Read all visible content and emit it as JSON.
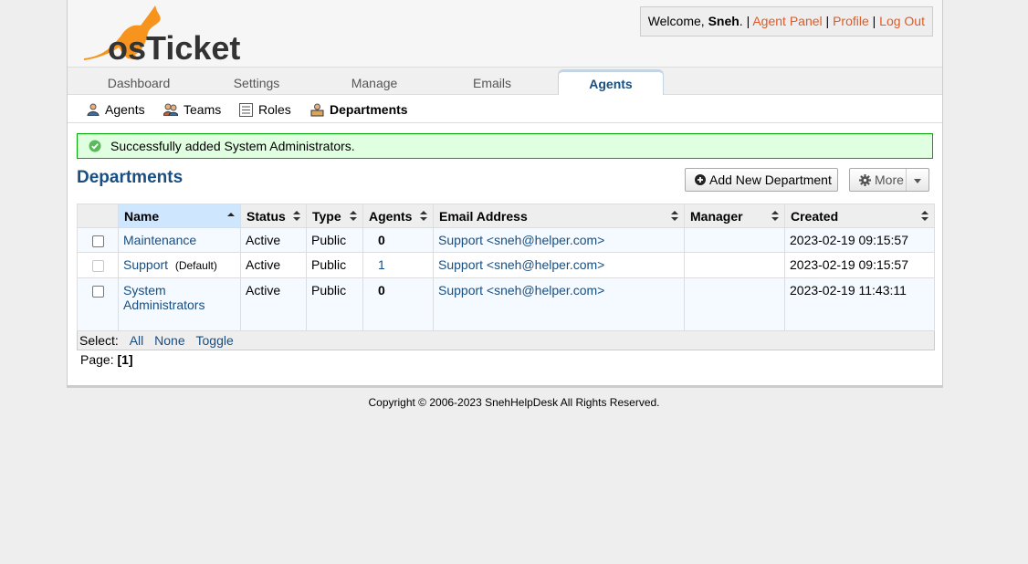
{
  "header": {
    "logo_text": "osTicket",
    "welcome_prefix": "Welcome, ",
    "username": "Sneh",
    "welcome_suffix": ".",
    "agent_panel": "Agent Panel",
    "profile": "Profile",
    "logout": "Log Out",
    "sep": " | "
  },
  "nav": {
    "tabs": [
      {
        "label": "Dashboard"
      },
      {
        "label": "Settings"
      },
      {
        "label": "Manage"
      },
      {
        "label": "Emails"
      },
      {
        "label": "Agents",
        "active": true
      }
    ]
  },
  "subnav": {
    "items": [
      {
        "label": "Agents",
        "icon": "user-icon"
      },
      {
        "label": "Teams",
        "icon": "team-icon"
      },
      {
        "label": "Roles",
        "icon": "roles-icon"
      },
      {
        "label": "Departments",
        "icon": "department-icon",
        "active": true
      }
    ]
  },
  "message": {
    "text": "Successfully added System Administrators.",
    "color": "#e0ffe0"
  },
  "page": {
    "title": "Departments",
    "add_button": "Add New Department",
    "more_button": "More"
  },
  "table": {
    "columns": [
      "Name",
      "Status",
      "Type",
      "Agents",
      "Email Address",
      "Manager",
      "Created"
    ],
    "rows": [
      {
        "name": "Maintenance",
        "default": "",
        "status": "Active",
        "type": "Public",
        "agents": "0",
        "email": "Support <sneh@helper.com>",
        "manager": "",
        "created": "2023-02-19 09:15:57"
      },
      {
        "name": "Support",
        "default": "(Default)",
        "status": "Active",
        "type": "Public",
        "agents": "1",
        "email": "Support <sneh@helper.com>",
        "manager": "",
        "created": "2023-02-19 09:15:57"
      },
      {
        "name": "System Administrators",
        "name_line1": "System",
        "name_line2": "Administrators",
        "default": "",
        "status": "Active",
        "type": "Public",
        "agents": "0",
        "email": "Support <sneh@helper.com>",
        "manager": "",
        "created": "2023-02-19 11:43:11"
      }
    ],
    "select_label": "Select:",
    "select_all": "All",
    "select_none": "None",
    "select_toggle": "Toggle"
  },
  "pager": {
    "label": "Page:",
    "current": "[1]"
  },
  "footer": {
    "text": "Copyright © 2006-2023 SnehHelpDesk All Rights Reserved."
  }
}
